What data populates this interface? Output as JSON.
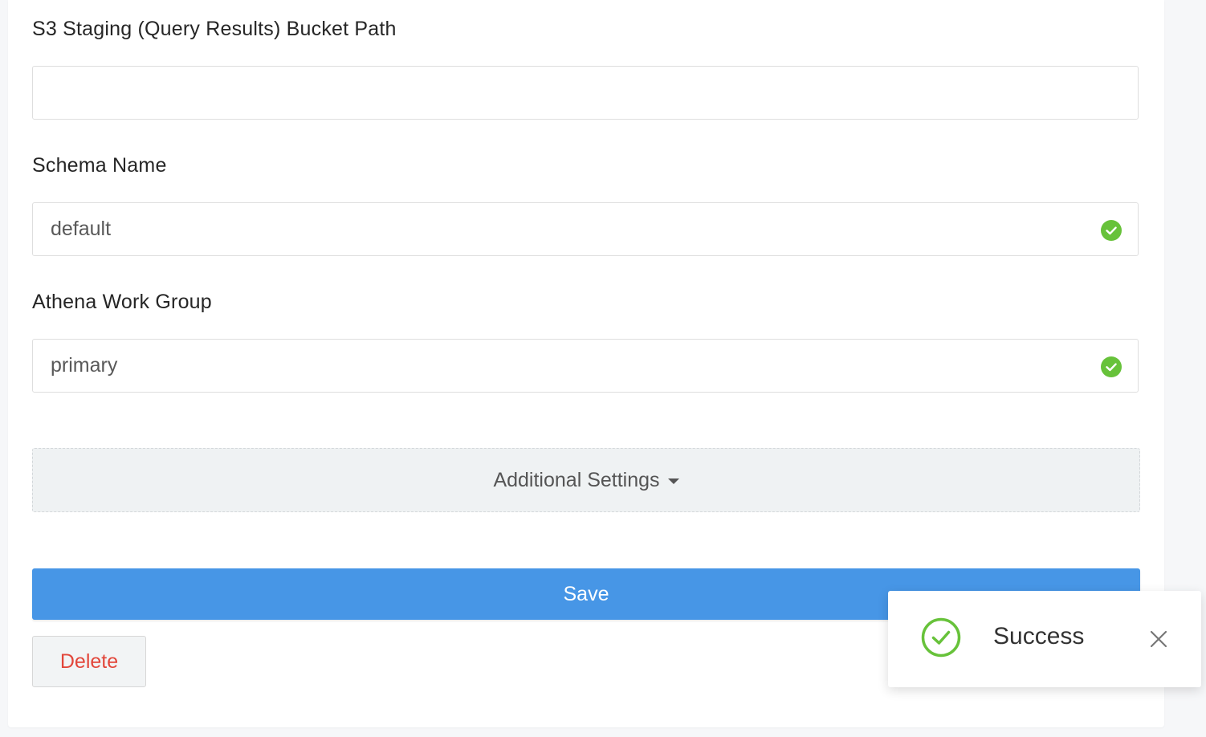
{
  "form": {
    "s3_label": "S3 Staging (Query Results) Bucket Path",
    "s3_value": "",
    "schema_label": "Schema Name",
    "schema_value": "default",
    "workgroup_label": "Athena Work Group",
    "workgroup_value": "primary",
    "additional_settings_label": "Additional Settings",
    "save_label": "Save",
    "delete_label": "Delete"
  },
  "toast": {
    "message": "Success"
  },
  "icons": {
    "valid": "check-circle-icon",
    "dropdown": "caret-down-icon",
    "toast_status": "check-circle-outline-icon",
    "toast_close": "close-icon"
  },
  "colors": {
    "primary": "#4796e6",
    "success": "#67c23a",
    "danger": "#e2463a"
  }
}
